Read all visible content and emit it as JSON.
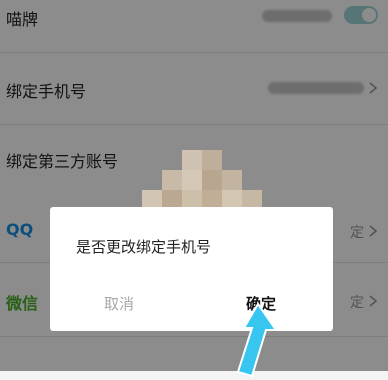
{
  "settings": {
    "nickname": {
      "label": "喵牌"
    },
    "bind_phone": {
      "label": "绑定手机号"
    },
    "bind_third_party": {
      "label": "绑定第三方账号"
    },
    "qq": {
      "label": "QQ",
      "status": "定"
    },
    "wechat": {
      "label": "微信",
      "status": "定"
    }
  },
  "dialog": {
    "message": "是否更改绑定手机号",
    "cancel_label": "取消",
    "confirm_label": "确定"
  },
  "colors": {
    "qq": "#1a8fe3",
    "wechat": "#4caf2a",
    "arrow": "#36c6ef",
    "toggle": "#9fd5d8"
  },
  "icons": {
    "chevron": "chevron-right-icon",
    "arrow": "pointer-arrow-icon"
  }
}
